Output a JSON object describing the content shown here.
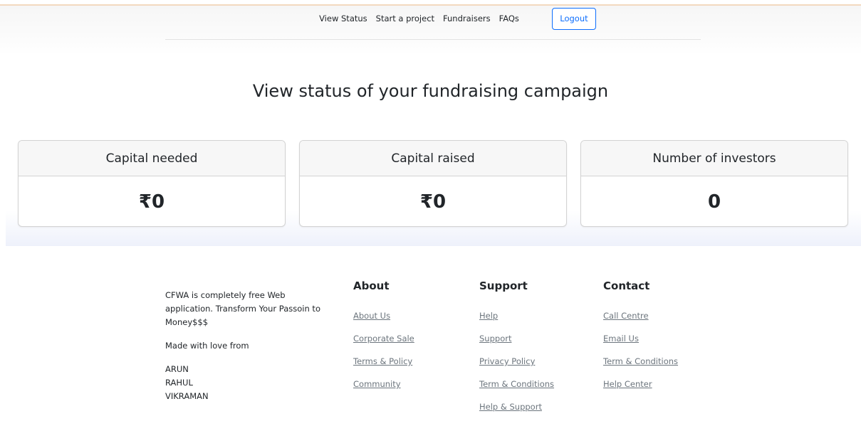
{
  "nav": {
    "links": [
      "View Status",
      "Start a project",
      "Fundraisers",
      "FAQs"
    ],
    "logout_label": "Logout"
  },
  "main": {
    "title": "View status of your fundraising campaign",
    "cards": [
      {
        "label": "Capital needed",
        "value": "₹0"
      },
      {
        "label": "Capital raised",
        "value": "₹0"
      },
      {
        "label": "Number of investors",
        "value": "0"
      }
    ]
  },
  "footer": {
    "description": "CFWA is completely free Web application. Transform Your Passoin to Money$$$",
    "made_with": "Made with love from",
    "team": [
      "ARUN",
      "RAHUL",
      "VIKRAMAN"
    ],
    "columns": [
      {
        "heading": "About",
        "links": [
          "About Us",
          "Corporate Sale",
          "Terms & Policy",
          "Community"
        ]
      },
      {
        "heading": "Support",
        "links": [
          "Help",
          "Support",
          "Privacy Policy",
          "Term & Conditions",
          "Help & Support"
        ]
      },
      {
        "heading": "Contact",
        "links": [
          "Call Centre",
          "Email Us",
          "Term & Conditions",
          "Help Center"
        ]
      }
    ]
  },
  "colors": {
    "primary": "#0d6efd",
    "text": "#212529",
    "link_muted": "#6c757d",
    "card_header_bg": "#f7f7f7",
    "card_border": "#d3d3d3"
  }
}
